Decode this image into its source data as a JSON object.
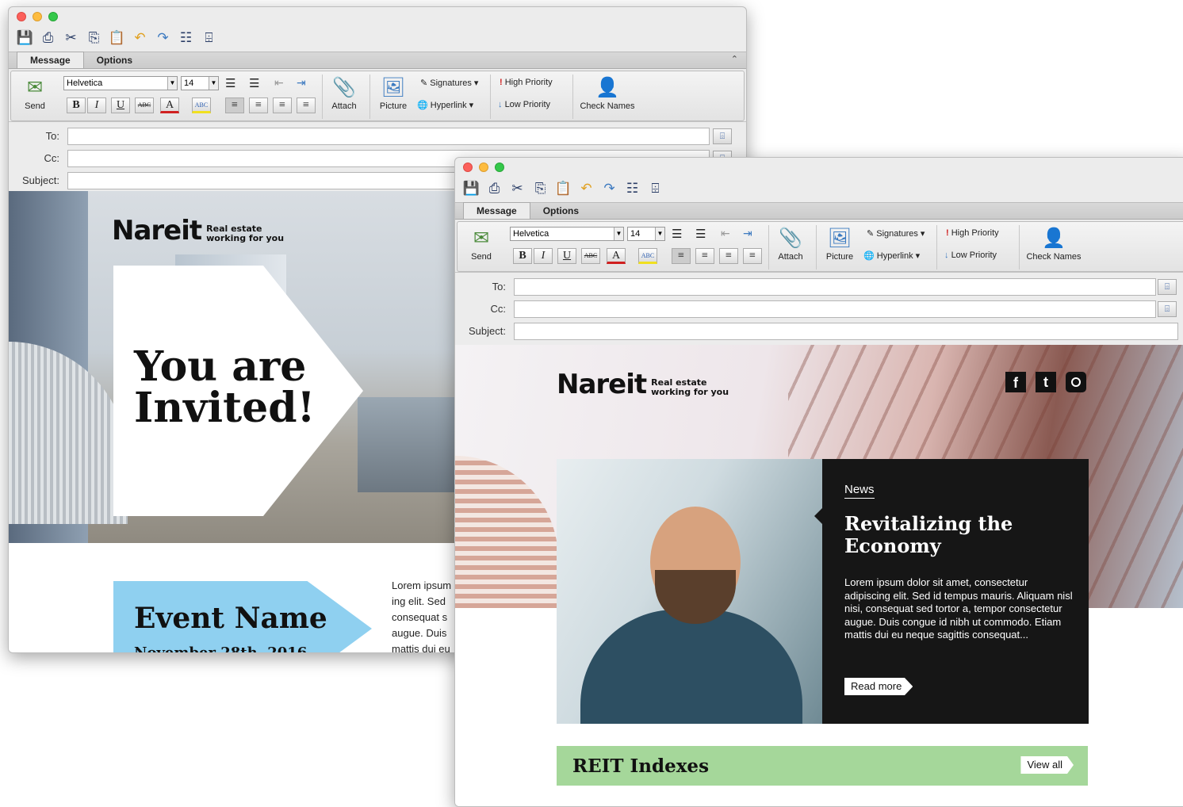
{
  "toolbar": {
    "tabs": [
      "Message",
      "Options"
    ],
    "font_name": "Helvetica",
    "font_size": "14",
    "send": "Send",
    "attach": "Attach",
    "picture": "Picture",
    "signatures": "Signatures",
    "hyperlink": "Hyperlink",
    "high_priority": "High Priority",
    "low_priority": "Low Priority",
    "check_names": "Check Names",
    "bold": "B",
    "italic": "I",
    "underline": "U",
    "strike": "ABC",
    "font_color": "A",
    "highlight": "ABC"
  },
  "fields": {
    "to": "To:",
    "cc": "Cc:",
    "subject": "Subject:"
  },
  "email1": {
    "brand": "Nareit",
    "tagline": "Real estate working for you",
    "headline_line1": "You are",
    "headline_line2": "Invited!",
    "event_name": "Event Name",
    "event_date": "November 28th, 2016",
    "body_lines": [
      "Lorem ipsum",
      "ing elit. Sed",
      "consequat s",
      "augue. Duis",
      "mattis dui eu"
    ]
  },
  "email2": {
    "brand": "Nareit",
    "tagline": "Real estate working for you",
    "social": [
      "facebook-icon",
      "twitter-icon",
      "instagram-icon"
    ],
    "news_label": "News",
    "news_title_line1": "Revitalizing the",
    "news_title_line2": "Economy",
    "news_body": "Lorem ipsum dolor sit amet, consectetur adipiscing elit. Sed id tempus mauris. Aliquam nisl nisi, consequat sed tortor a, tempor consectetur augue. Duis congue id nibh ut commodo. Etiam mattis dui eu neque sagittis consequat...",
    "read_more": "Read more",
    "reit_title": "REIT Indexes",
    "view_all": "View all"
  },
  "colors": {
    "event_banner": "#8fd0f0",
    "reit_banner": "#a5d79a",
    "news_panel": "#161616"
  }
}
